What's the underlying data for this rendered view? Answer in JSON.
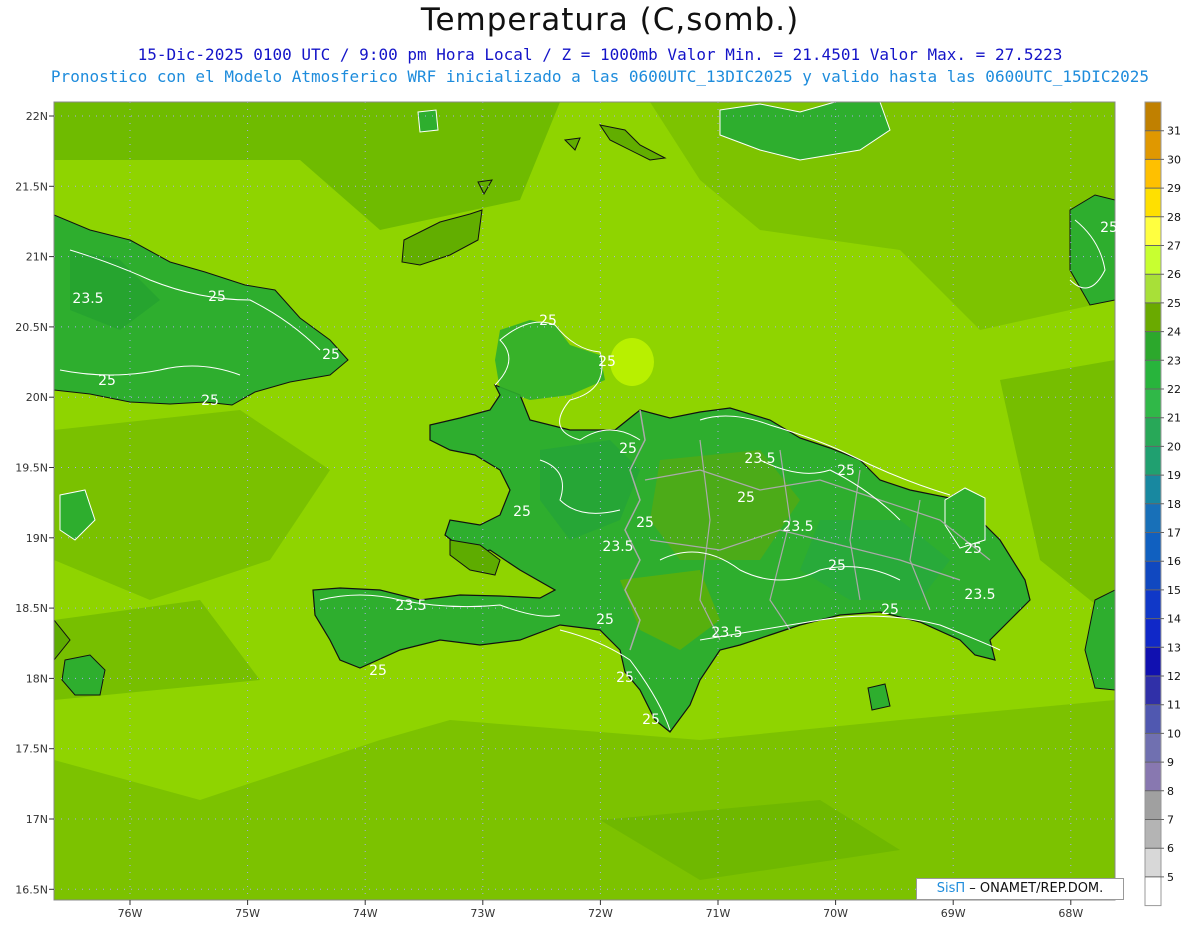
{
  "title": "Temperatura (C,somb.)",
  "subtitle1": "15-Dic-2025  0100 UTC / 9:00 pm Hora Local / Z = 1000mb   Valor Min. = 21.4501  Valor Max. = 27.5223",
  "subtitle2": "Pronostico con el Modelo Atmosferico WRF inicializado a las 0600UTC_13DIC2025 y valido hasta las  0600UTC_15DIC2025",
  "credit": {
    "brand": "SisΠ",
    "text": "– ONAMET/REP.DOM."
  },
  "lat_labels": [
    "22N",
    "21.5N",
    "21N",
    "20.5N",
    "20N",
    "19.5N",
    "19N",
    "18.5N",
    "18N",
    "17.5N",
    "17N",
    "16.5N"
  ],
  "lon_labels": [
    "76W",
    "75W",
    "74W",
    "73W",
    "72W",
    "71W",
    "70W",
    "69W",
    "68W"
  ],
  "contour_labels": [
    "23.5",
    "25",
    "25",
    "25",
    "25",
    "25",
    "25",
    "25",
    "25",
    "23.5",
    "25",
    "25",
    "23.5",
    "23.5",
    "25",
    "25",
    "23.5",
    "25",
    "25",
    "23.5",
    "23.5",
    "25",
    "25",
    "25",
    "25",
    "25"
  ],
  "colorbar": {
    "levels": [
      "31",
      "30",
      "29",
      "28",
      "27",
      "26",
      "25",
      "24",
      "23",
      "22",
      "21",
      "20",
      "19",
      "18",
      "17",
      "16",
      "15",
      "14",
      "13",
      "12",
      "11",
      "10",
      "9",
      "8",
      "7",
      "6",
      "5"
    ],
    "colors": [
      "#c08000",
      "#e09800",
      "#ffc000",
      "#ffe000",
      "#ffff40",
      "#c8ff30",
      "#a8e038",
      "#6aaa00",
      "#2ca82c",
      "#28b43c",
      "#30b848",
      "#28a858",
      "#20a070",
      "#1888a0",
      "#1870b8",
      "#1060c0",
      "#1048c0",
      "#1038c8",
      "#1028c8",
      "#1010b0",
      "#3030a8",
      "#5058b0",
      "#7070b0",
      "#8878b0",
      "#a0a0a0",
      "#b4b4b4",
      "#d8d8d8",
      "#ffffff"
    ]
  },
  "colors": {
    "sea": "#8fd400",
    "land": "#5eac00",
    "land_warm": "#2eae2e",
    "contour_white": "#ffffff",
    "border_gray": "#aaaaaa"
  }
}
